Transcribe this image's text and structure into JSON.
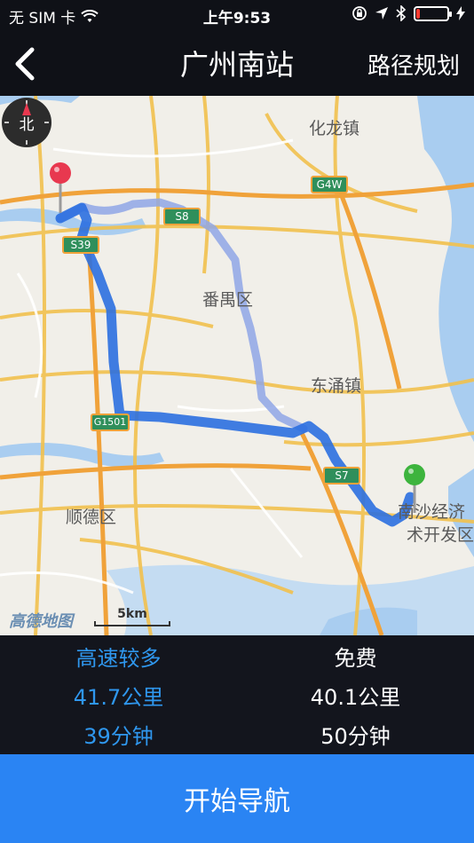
{
  "status_bar": {
    "carrier": "无 SIM 卡",
    "time": "上午9:53"
  },
  "nav": {
    "title": "广州南站",
    "route_plan_label": "路径规划"
  },
  "map": {
    "labels": {
      "hualong": "化龙镇",
      "panyu": "番禺区",
      "dongchong": "东涌镇",
      "shunde": "顺德区",
      "nansha_1": "南沙经济",
      "nansha_2": "术开发区"
    },
    "highway_shields": {
      "g4w": "G4W",
      "s39": "S39",
      "s8": "S8",
      "g1501": "G1501",
      "s7": "S7"
    },
    "compass_label": "北",
    "scale_label": "5km",
    "logo_text": "高德地图",
    "colors": {
      "primary_route": "#2b6fe0",
      "alt_route": "#8fa6e6",
      "start_pin": "#e8384f",
      "end_pin": "#3db43d",
      "water": "#a9cdf0"
    }
  },
  "routes": [
    {
      "tag": "高速较多",
      "distance": "41.7公里",
      "duration": "39分钟"
    },
    {
      "tag": "免费",
      "distance": "40.1公里",
      "duration": "50分钟"
    }
  ],
  "start_button_label": "开始导航",
  "battery_level": 0.1
}
